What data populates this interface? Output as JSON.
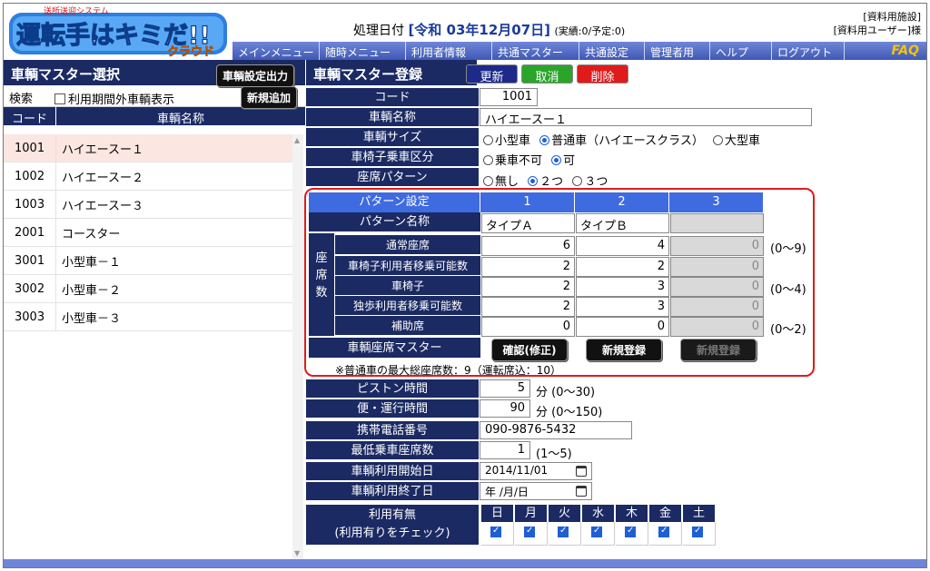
{
  "app": {
    "logo_top": "送所送迎システム",
    "logo_main": "運転手はキミだ!!",
    "logo_sub": "クラウド",
    "proc_label": "処理日付",
    "proc_date": "[令和 03年12月07日]",
    "proc_counts": "(実績:0/予定:0)",
    "facility": "[資料用施設]",
    "user": "[資料用ユーザー]様",
    "faq": "FAQ"
  },
  "menu": [
    "メインメニュー",
    "随時メニュー",
    "利用者情報",
    "共通マスター",
    "共通設定",
    "管理者用",
    "ヘルプ",
    "ログアウト"
  ],
  "left": {
    "title": "車輌マスター選択",
    "output_button": "車輌設定出力",
    "search_label": "検索",
    "outside_checkbox_label": "利用期間外車輌表示",
    "new_button": "新規追加",
    "col_code": "コード",
    "col_name": "車輌名称",
    "vehicles": [
      {
        "code": "1001",
        "name": "ハイエースー１"
      },
      {
        "code": "1002",
        "name": "ハイエースー２"
      },
      {
        "code": "1003",
        "name": "ハイエースー３"
      },
      {
        "code": "2001",
        "name": "コースター"
      },
      {
        "code": "3001",
        "name": "小型車－１"
      },
      {
        "code": "3002",
        "name": "小型車－２"
      },
      {
        "code": "3003",
        "name": "小型車－３"
      }
    ]
  },
  "form": {
    "title": "車輌マスター登録",
    "update_button": "更新",
    "cancel_button": "取消",
    "delete_button": "削除",
    "code_label": "コード",
    "code_value": "1001",
    "name_label": "車輌名称",
    "name_value": "ハイエースー１",
    "size_label": "車輌サイズ",
    "size_options": [
      "小型車",
      "普通車（ハイエースクラス）",
      "大型車"
    ],
    "wheelchair_label": "車椅子乗車区分",
    "wheelchair_options": [
      "乗車不可",
      "可"
    ],
    "pattern_label": "座席パターン",
    "pattern_options": [
      "無し",
      "２つ",
      "３つ"
    ],
    "pattern_setting_label": "パターン設定",
    "pattern_cols": [
      "1",
      "2",
      "3"
    ],
    "pattern_name_label": "パターン名称",
    "pattern_names": [
      "タイプＡ",
      "タイプＢ",
      ""
    ],
    "seat_side_label": "座席数",
    "seat_side_chars": [
      "座",
      "席",
      "数"
    ],
    "seat_rows": [
      {
        "label": "通常座席",
        "values": [
          "6",
          "4",
          "0"
        ],
        "range": "(0～9)"
      },
      {
        "label": "車椅子利用者移乗可能数",
        "values": [
          "2",
          "2",
          "0"
        ],
        "range": ""
      },
      {
        "label": "車椅子",
        "values": [
          "2",
          "3",
          "0"
        ],
        "range": "(0～4)"
      },
      {
        "label": "独歩利用者移乗可能数",
        "values": [
          "2",
          "3",
          "0"
        ],
        "range": ""
      },
      {
        "label": "補助席",
        "values": [
          "0",
          "0",
          "0"
        ],
        "range": "(0～2)"
      }
    ],
    "seat_master_label": "車輌座席マスター",
    "confirm_button": "確認(修正)",
    "new_reg_button": "新規登録",
    "new_reg_button_disabled": "新規登録",
    "max_note": "※普通車の最大総座席数：9（運転席込：10）",
    "piston_label": "ピストン時間",
    "piston_value": "5",
    "piston_unit": "分",
    "piston_range": "(0～30)",
    "trip_label": "便・運行時間",
    "trip_value": "90",
    "trip_unit": "分",
    "trip_range": "(0～150)",
    "phone_label": "携帯電話番号",
    "phone_value": "090-9876-5432",
    "min_label": "最低乗車座席数",
    "min_value": "1",
    "min_range": "(1～5)",
    "start_label": "車輌利用開始日",
    "start_value": "2014/11/01",
    "end_label": "車輌利用終了日",
    "end_value": "年 /月/日",
    "usage_label1": "利用有無",
    "usage_label2": "(利用有りをチェック)",
    "weekdays": [
      "日",
      "月",
      "火",
      "水",
      "木",
      "金",
      "土"
    ]
  },
  "colors": {
    "navy": "#1b2a63",
    "menu_blue": "#3f58b4",
    "pattern_header": "#3f6be0",
    "highlight_red": "#e01b1b",
    "selected_row": "#fbe6e1"
  }
}
